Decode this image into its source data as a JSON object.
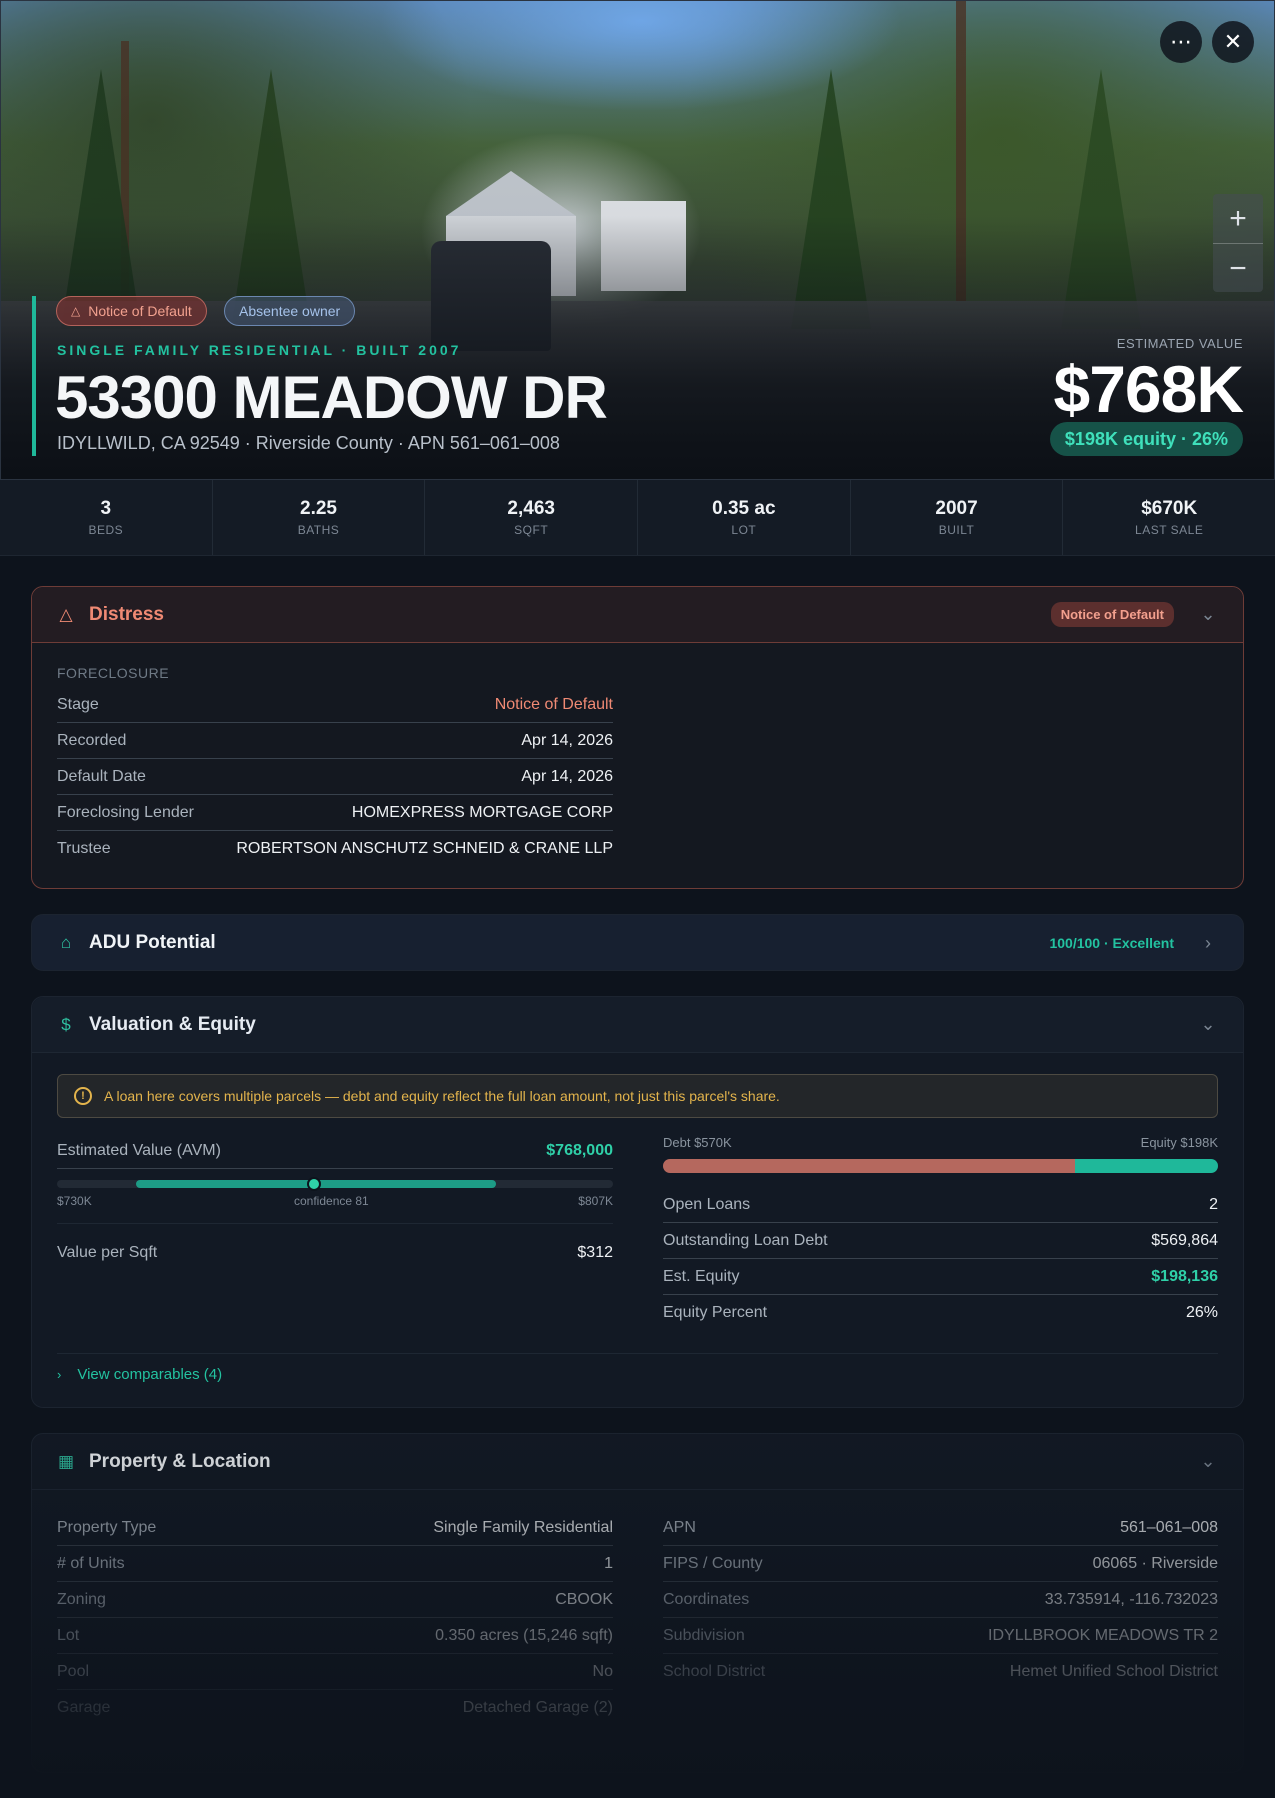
{
  "hero": {
    "chips": {
      "distress": "Notice of Default",
      "owner": "Absentee owner"
    },
    "subtitle": "SINGLE FAMILY RESIDENTIAL · BUILT 2007",
    "title": "53300 MEADOW DR",
    "address": "IDYLLWILD, CA 92549 · Riverside County · APN 561–061–008",
    "estimated_label": "ESTIMATED VALUE",
    "estimated_value": "$768K",
    "equity_pill": "$198K equity · 26%",
    "icons": {
      "more": "more-icon",
      "close": "close-icon",
      "zoom_in": "plus-icon",
      "zoom_out": "minus-icon"
    }
  },
  "stats": [
    {
      "value": "3",
      "label": "BEDS"
    },
    {
      "value": "2.25",
      "label": "BATHS"
    },
    {
      "value": "2,463",
      "label": "SQFT"
    },
    {
      "value": "0.35 ac",
      "label": "LOT"
    },
    {
      "value": "2007",
      "label": "BUILT"
    },
    {
      "value": "$670K",
      "label": "LAST SALE"
    }
  ],
  "distress": {
    "title": "Distress",
    "badge": "Notice of Default",
    "section": "FORECLOSURE",
    "rows": [
      {
        "k": "Stage",
        "v": "Notice of Default"
      },
      {
        "k": "Recorded",
        "v": "Apr 14, 2026"
      },
      {
        "k": "Default Date",
        "v": "Apr 14, 2026"
      },
      {
        "k": "Foreclosing Lender",
        "v": "HOMEXPRESS MORTGAGE CORP"
      },
      {
        "k": "Trustee",
        "v": "ROBERTSON ANSCHUTZ SCHNEID & CRANE LLP"
      }
    ]
  },
  "adu": {
    "title": "ADU Potential",
    "score": "100/100 · Excellent"
  },
  "valuation": {
    "title": "Valuation & Equity",
    "warning": "A loan here covers multiple parcels — debt and equity reflect the full loan amount, not just this parcel's share.",
    "avm_label": "Estimated Value (AVM)",
    "avm_value": "$768,000",
    "avm_low": "$730K",
    "avm_high": "$807K",
    "confidence": "confidence 81",
    "avm_range": {
      "low": 730000,
      "high": 807000,
      "value": 768000
    },
    "value_per_sqft_label": "Value per Sqft",
    "value_per_sqft": "$312",
    "debt_label": "Debt $570K",
    "equity_label": "Equity $198K",
    "debt_equity": {
      "debt": 569864,
      "equity": 198136
    },
    "rows": [
      {
        "k": "Open Loans",
        "v": "2"
      },
      {
        "k": "Outstanding Loan Debt",
        "v": "$569,864"
      },
      {
        "k": "Est. Equity",
        "v": "$198,136"
      },
      {
        "k": "Equity Percent",
        "v": "26%"
      }
    ],
    "comparables": "View comparables (4)"
  },
  "property": {
    "title": "Property & Location",
    "left": [
      {
        "k": "Property Type",
        "v": "Single Family Residential"
      },
      {
        "k": "# of Units",
        "v": "1"
      },
      {
        "k": "Zoning",
        "v": "CBOOK"
      },
      {
        "k": "Lot",
        "v": "0.350 acres (15,246 sqft)"
      },
      {
        "k": "Pool",
        "v": "No"
      },
      {
        "k": "Garage",
        "v": "Detached Garage (2)"
      }
    ],
    "right": [
      {
        "k": "APN",
        "v": "561–061–008"
      },
      {
        "k": "FIPS / County",
        "v": "06065 · Riverside"
      },
      {
        "k": "Coordinates",
        "v": "33.735914, -116.732023"
      },
      {
        "k": "Subdivision",
        "v": "IDYLLBROOK MEADOWS TR 2"
      },
      {
        "k": "School District",
        "v": "Hemet Unified School District"
      }
    ]
  },
  "colors": {
    "accent": "#1fb89a",
    "distress": "#f08a74",
    "debt": "#b5685e",
    "warning": "#e3b44c"
  }
}
